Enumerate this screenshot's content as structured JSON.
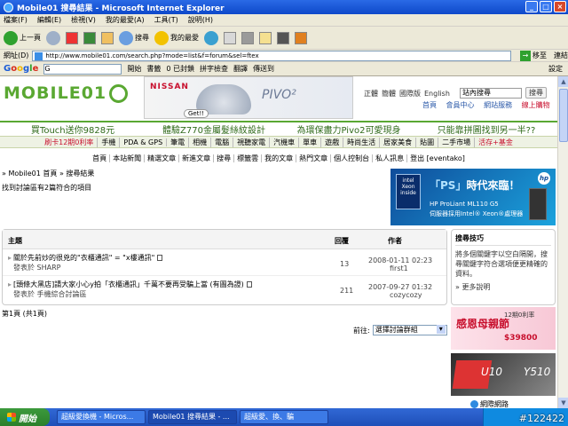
{
  "window": {
    "title": "Mobile01 搜尋結果 - Microsoft Internet Explorer",
    "controls": [
      "_",
      "□",
      "×"
    ]
  },
  "menu": [
    "檔案(F)",
    "編輯(E)",
    "檢視(V)",
    "我的最愛(A)",
    "工具(T)",
    "說明(H)"
  ],
  "toolbar": {
    "back": "上一頁",
    "search": "搜尋",
    "favorites": "我的最愛"
  },
  "address": {
    "label": "網址(D)",
    "url": "http://www.mobile01.com/search.php?mode=list&f=forum&sel=ftex",
    "go": "移至",
    "links": "連結"
  },
  "googlebar": {
    "logo_letters": [
      "G",
      "o",
      "o",
      "g",
      "l",
      "e"
    ],
    "search_value": "G",
    "start": "開始",
    "bookmarks": "書籤",
    "blocked": "0 已封鎖",
    "spellcheck": "拼字檢查",
    "translate": "翻譯",
    "send": "傳送到",
    "settings": "設定"
  },
  "site": {
    "logo": "MOBILE01",
    "banner": {
      "brand": "NISSAN",
      "product": "PIVO²",
      "button": "Get!!"
    },
    "toplinks": [
      "正體",
      "簡體",
      "國際版",
      "English"
    ],
    "search_value": "站內搜尋",
    "search_btn": "搜尋",
    "nav": [
      {
        "label": "首頁",
        "red": false
      },
      {
        "label": "會員中心",
        "red": false
      },
      {
        "label": "網站服務",
        "red": false
      },
      {
        "label": "線上購物",
        "red": true
      }
    ],
    "promos": [
      "買Touch送你9828元",
      "體驗Z770金屬髮絲紋設計",
      "為環保盡力Pivo2可愛現身",
      "只能靠拼圖找到另一半??"
    ],
    "categories": [
      {
        "label": "刷卡12期0利率",
        "red": true
      },
      {
        "label": "手機",
        "red": false
      },
      {
        "label": "PDA & GPS",
        "red": false
      },
      {
        "label": "筆電",
        "red": false
      },
      {
        "label": "相機",
        "red": false
      },
      {
        "label": "電腦",
        "red": false
      },
      {
        "label": "視聽家電",
        "red": false
      },
      {
        "label": "汽機車",
        "red": false
      },
      {
        "label": "單車",
        "red": false
      },
      {
        "label": "遊戲",
        "red": false
      },
      {
        "label": "時尚生活",
        "red": false
      },
      {
        "label": "居家美食",
        "red": false
      },
      {
        "label": "貼圖",
        "red": false
      },
      {
        "label": "二手市場",
        "red": false
      },
      {
        "label": "活存+基金",
        "red": true
      }
    ],
    "subnav": [
      "首頁",
      "本站新聞",
      "精選文章",
      "新進文章",
      "搜尋",
      "標籤雲",
      "我的文章",
      "熱門文章",
      "個人控制台",
      "私人訊息",
      "登出 [eventako]"
    ],
    "breadcrumb": "» Mobile01 首頁 » 搜尋結果",
    "found": "找到討論區有2篇符合的項目"
  },
  "hp_ad": {
    "intel": "intel Xeon inside",
    "headline_a": "「PS」",
    "headline_b": "時代來臨！",
    "line1": "HP ProLiant ML110 G5",
    "line2": "伺服器採用Intel® Xeon®處理器",
    "hp": "hp"
  },
  "results": {
    "headers": {
      "topic": "主題",
      "replies": "回覆",
      "author": "作者"
    },
    "rows": [
      {
        "title": "關於先前炒的很兇的\"衣櫃通訊\" = \"x樓通訊\"",
        "forum": "發表於 SHARP",
        "replies": "13",
        "date": "2008-01-11 02:23",
        "author": "first1"
      },
      {
        "title": "[頭條大黑店]請大家小心y拍「衣櫃通訊」千萬不要再受騙上當 (有圖為證)",
        "forum": "發表於 手機綜合討論區",
        "replies": "211",
        "date": "2007-09-27 01:32",
        "author": "cozycozy"
      }
    ]
  },
  "tips": {
    "title": "搜尋技巧",
    "body": "將多個關鍵字以空白隔開，搜尋關鍵字符合選項便更精確的資料。",
    "more": "» 更多說明"
  },
  "pageinfo": "第1頁 (共1頁)",
  "goto": {
    "label": "前往:",
    "value": "選擇討論群組"
  },
  "ad2": {
    "big": "感恩母親節",
    "line": "12期0利率",
    "price": "$39800"
  },
  "ad3": {
    "model1": "U10",
    "model2": "Y510"
  },
  "statusbar": {
    "zone": "網際網路"
  },
  "taskbar": {
    "start": "開始",
    "tasks": [
      "超級愛換機 - Micros...",
      "Mobile01 搜尋結果 - ...",
      "超級愛、換、騙"
    ],
    "watermark": "#122422"
  },
  "colors": {
    "brand_green": "#5aa832",
    "accent_red": "#c8102e",
    "link_blue": "#2a58a8"
  }
}
